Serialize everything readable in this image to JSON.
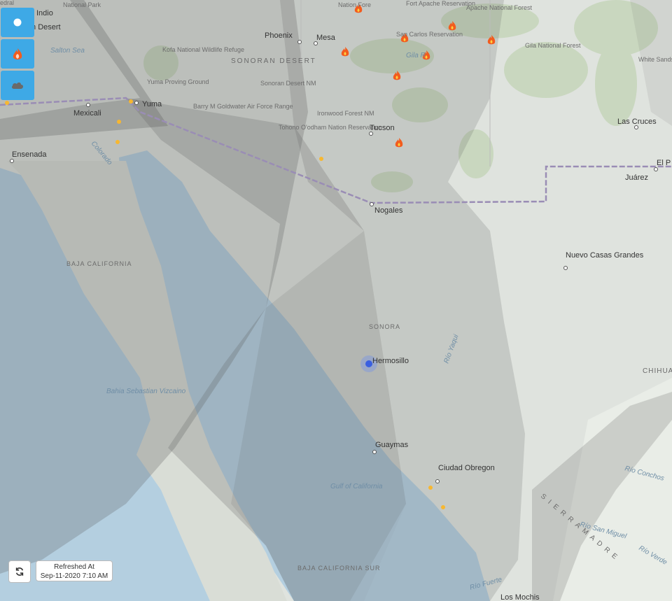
{
  "controls": {
    "location_icon": "circle-icon",
    "fires_icon": "fire-icon",
    "smoke_icon": "cloud-icon"
  },
  "refresh": {
    "title": "Refreshed At",
    "timestamp": "Sep-11-2020 7:10 AM"
  },
  "map": {
    "labels": {
      "indio": "Indio",
      "m_desert": "m Desert",
      "edral": "edral",
      "national_park": "National Park",
      "salton_sea": "Salton Sea",
      "phoenix": "Phoenix",
      "mesa": "Mesa",
      "sonoran_desert": "SONORAN DESERT",
      "kofa": "Kofa National Wildlife Refuge",
      "yuma_proving": "Yuma Proving Ground",
      "sonoran_nm": "Sonoran Desert NM",
      "yuma": "Yuma",
      "mexicali": "Mexicali",
      "barry": "Barry M Goldwater Air Force Range",
      "ironwood": "Ironwood Forest NM",
      "tohono": "Tohono O'odham Nation Reservation",
      "tucson": "Tucson",
      "ensenada": "Ensenada",
      "colorado": "Colorado",
      "nogales": "Nogales",
      "fort_apache": "Fort Apache Reservation",
      "nation_fore": "Nation Fore",
      "apache_nf": "Apache National Forest",
      "san_carlos": "San Carlos Reservation",
      "gila_r": "Gila R",
      "gila_nf": "Gila National Forest",
      "white_sands": "White Sands Missile Range",
      "las_cruces": "Las Cruces",
      "el_p": "El P",
      "juarez": "Juárez",
      "nuevo_casas": "Nuevo Casas Grandes",
      "baja_california": "BAJA CALIFORNIA",
      "sonora": "SONORA",
      "hermosillo": "Hermosillo",
      "yaqui": "Río Yaqui",
      "chihua": "CHIHUA",
      "bahia": "Bahia Sebastian Vizcaino",
      "guaymas": "Guaymas",
      "ciudad_obregon": "Ciudad Obregon",
      "gulf": "Gulf of California",
      "rio_conchos": "Río Conchos",
      "rio_san_miguel": "Río San Miguel",
      "rio_verde": "Río Verde",
      "sierra_madre": "S I E R R A   M A D R E",
      "baja_sur": "BAJA CALIFORNIA SUR",
      "rio_fuerte": "Río Fuerte",
      "los_mochis": "Los Mochis"
    }
  }
}
